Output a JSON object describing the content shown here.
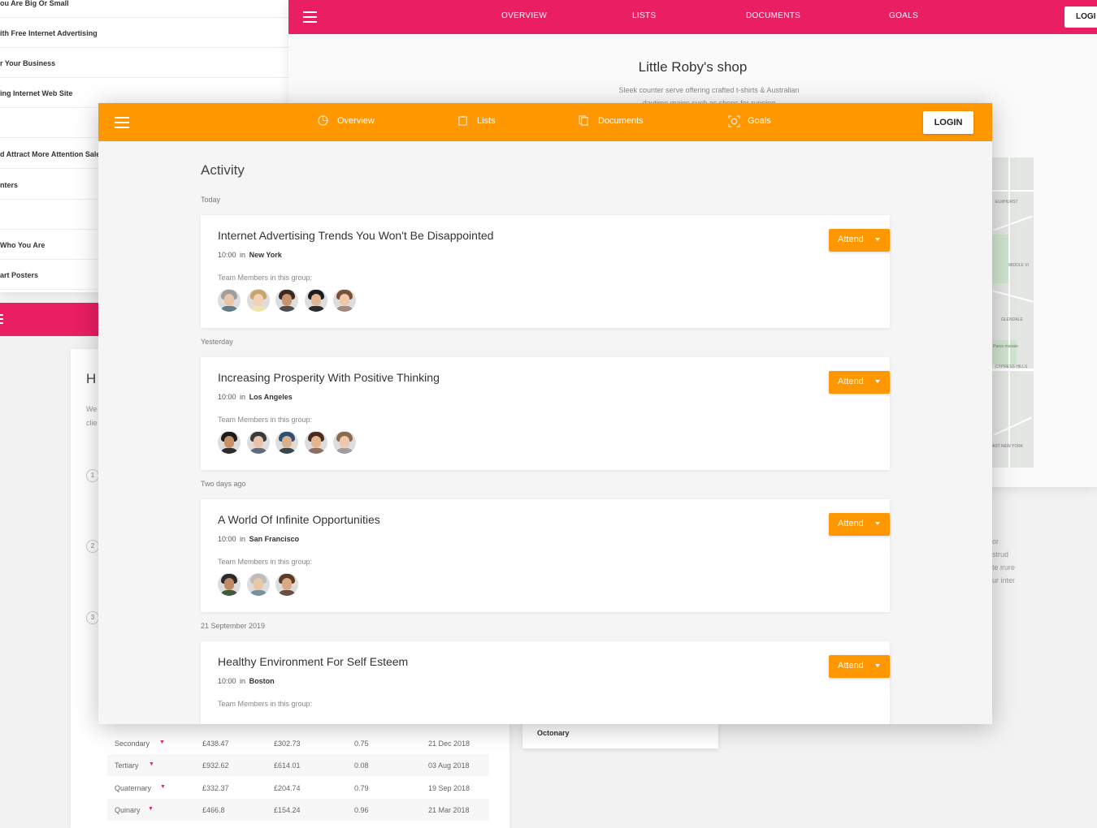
{
  "background": {
    "left_list": [
      "ou Are Big Or Small",
      "ith Free Internet Advertising",
      "r Your Business",
      "ing Internet Web Site",
      "",
      "d Attract More Attention Sale",
      "nters",
      "",
      "Who You Are",
      "art Posters"
    ],
    "pink_nav": {
      "links": [
        "OVERVIEW",
        "LISTS",
        "DOCUMENTS",
        "GOALS"
      ],
      "login": "LOGI"
    },
    "shop": {
      "title": "Little Roby's shop",
      "subtitle": "Sleek counter serve offering crafted t-shirts & Australian",
      "subtitle2": "daytime mains such as shops for running"
    },
    "map_labels": [
      "ELMHURST",
      "MIDDLE VI",
      "GLENDALE",
      "Parco munale",
      "CYPRESS HILLS",
      "AST NEW YORK"
    ],
    "right_fragments": [
      "or",
      "strud",
      "te irure",
      "ur inter"
    ],
    "bottom_card": {
      "title": "H",
      "text1": "We",
      "text2": "clie",
      "steps": [
        "1",
        "2",
        "3"
      ]
    },
    "table_rows": [
      {
        "name": "Secondary",
        "a": "£438.47",
        "b": "£302.73",
        "c": "0.75",
        "date": "21 Dec 2018"
      },
      {
        "name": "Tertiary",
        "a": "£932.62",
        "b": "£614.01",
        "c": "0.08",
        "date": "03 Aug 2018"
      },
      {
        "name": "Quaternary",
        "a": "£332.37",
        "b": "£204.74",
        "c": "0.79",
        "date": "19 Sep 2018"
      },
      {
        "name": "Quinary",
        "a": "£466.8",
        "b": "£154.24",
        "c": "0.96",
        "date": "21 Mar 2018"
      }
    ],
    "octonary": "Octonary"
  },
  "nav": {
    "links": [
      {
        "label": "Overview",
        "icon": "pie-chart-icon"
      },
      {
        "label": "Lists",
        "icon": "clipboard-icon"
      },
      {
        "label": "Documents",
        "icon": "documents-icon"
      },
      {
        "label": "Goals",
        "icon": "target-icon"
      }
    ],
    "login": "LOGIN"
  },
  "activity": {
    "title": "Activity",
    "team_label": "Team Members in this group:",
    "attend_label": "Attend",
    "sections": [
      {
        "day": "Today",
        "title": "Internet Advertising Trends You Won't Be Disappointed",
        "time": "10:00",
        "sep": "in",
        "city": "New York",
        "avatars": [
          {
            "skin": "#e8c4a8",
            "hair": "#9e9e9e",
            "shirt": "#607d8b"
          },
          {
            "skin": "#f3d2b3",
            "hair": "#c9a46b",
            "shirt": "#f1e4a8"
          },
          {
            "skin": "#c8946f",
            "hair": "#3b2a22",
            "shirt": "#4e4e4e"
          },
          {
            "skin": "#e0b795",
            "hair": "#1e1e1e",
            "shirt": "#2b2b2b"
          },
          {
            "skin": "#efc7aa",
            "hair": "#7a4f38",
            "shirt": "#a1887f"
          }
        ]
      },
      {
        "day": "Yesterday",
        "title": "Increasing Prosperity With Positive Thinking",
        "time": "10:00",
        "sep": "in",
        "city": "Los Angeles",
        "avatars": [
          {
            "skin": "#c98f66",
            "hair": "#1b1b1b",
            "shirt": "#2c2c2c"
          },
          {
            "skin": "#e8c3a6",
            "hair": "#3a3a3a",
            "shirt": "#5d6d7e"
          },
          {
            "skin": "#d9b08c",
            "hair": "#2e4f6e",
            "shirt": "#37474f"
          },
          {
            "skin": "#e4b58e",
            "hair": "#4a2c1c",
            "shirt": "#8d6e63"
          },
          {
            "skin": "#efc9ad",
            "hair": "#8a6a4f",
            "shirt": "#9e9e9e"
          }
        ]
      },
      {
        "day": "Two days ago",
        "title": "A World Of Infinite Opportunities",
        "time": "10:00",
        "sep": "in",
        "city": "San Francisco",
        "avatars": [
          {
            "skin": "#c08a65",
            "hair": "#2a2a2a",
            "shirt": "#3e5b3e"
          },
          {
            "skin": "#e9c7a9",
            "hair": "#bdbdbd",
            "shirt": "#78909c"
          },
          {
            "skin": "#d8aa84",
            "hair": "#5b3b26",
            "shirt": "#6d4c41"
          }
        ]
      },
      {
        "day": "21 September 2019",
        "title": "Healthy Environment For Self Esteem",
        "time": "10:00",
        "sep": "in",
        "city": "Boston",
        "avatars": []
      }
    ]
  }
}
